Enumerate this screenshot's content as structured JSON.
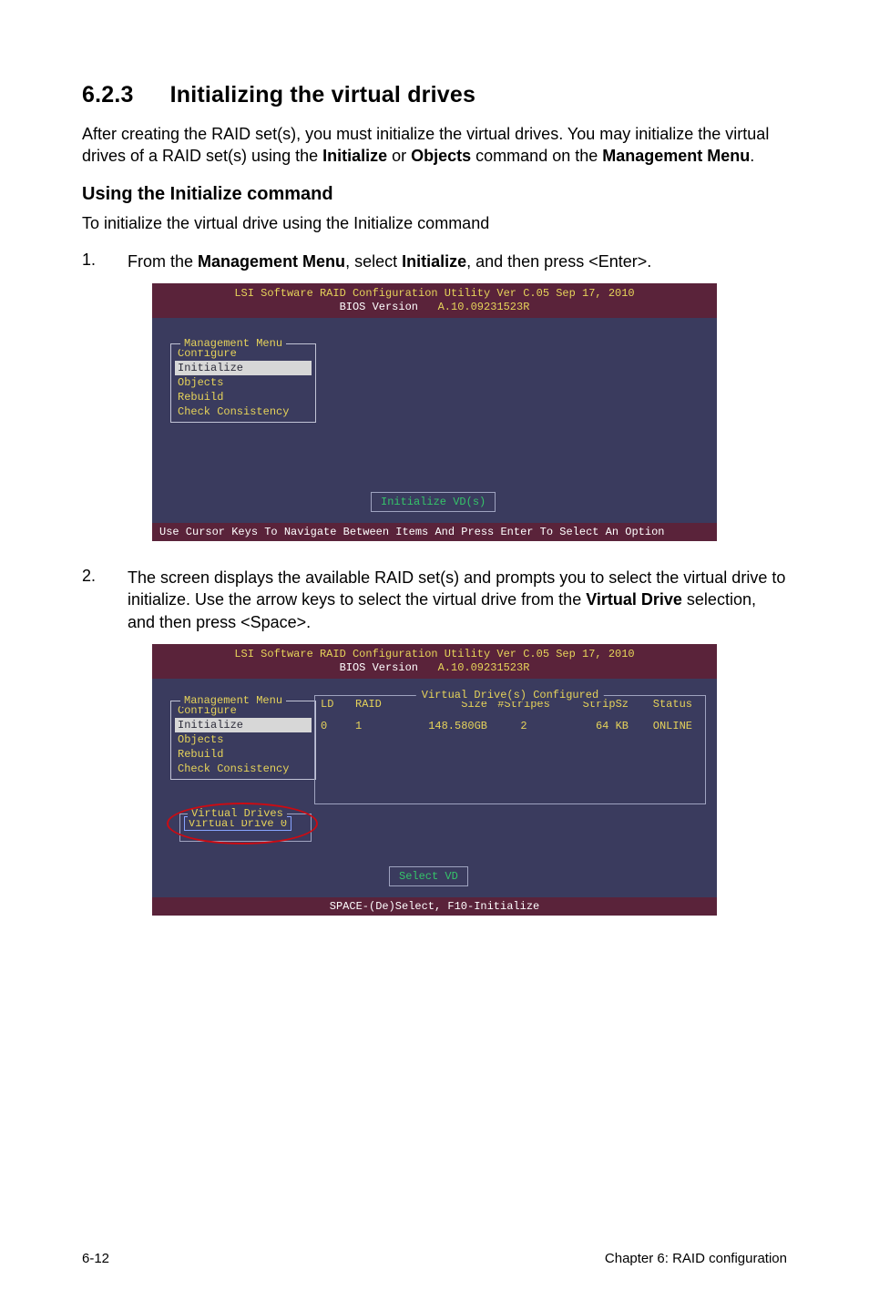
{
  "section": {
    "number": "6.2.3",
    "title": "Initializing the virtual drives"
  },
  "intro": {
    "part1": "After creating the RAID set(s), you must initialize the virtual drives. You may initialize the virtual drives of a RAID set(s) using the ",
    "bold1": "Initialize",
    "mid1": " or ",
    "bold2": "Objects",
    "mid2": " command on the ",
    "bold3": "Management Menu",
    "end": "."
  },
  "subhead": "Using the Initialize command",
  "subintro": "To initialize the virtual drive using the Initialize command",
  "step1": {
    "num": "1.",
    "pre": "From the ",
    "bold1": "Management Menu",
    "mid": ", select ",
    "bold2": "Initialize",
    "post": ", and then press <Enter>."
  },
  "step2": {
    "num": "2.",
    "part1": "The screen displays the available RAID set(s) and prompts you to select the virtual drive to initialize. Use the arrow keys to select the virtual drive from the ",
    "bold1": "Virtual Drive",
    "part2": " selection, and then press <Space>."
  },
  "bios_common": {
    "header_line1": "LSI Software RAID Configuration Utility Ver C.05 Sep 17, 2010",
    "header_line2_label": "BIOS Version",
    "header_line2_value": "A.10.09231523R",
    "menu_title": "Management Menu",
    "menu_items": {
      "configure": "Configure",
      "initialize": "Initialize",
      "objects": "Objects",
      "rebuild": "Rebuild",
      "check": "Check Consistency"
    }
  },
  "bios1": {
    "action": "Initialize VD(s)",
    "footer": "Use Cursor Keys To Navigate Between Items And Press Enter To Select An Option"
  },
  "bios2": {
    "table_title": "Virtual Drive(s) Configured",
    "headers": {
      "ld": "LD",
      "raid": "RAID",
      "size": "Size",
      "stripes": "#Stripes",
      "stripsz": "StripSz",
      "status": "Status"
    },
    "row0": {
      "ld": "0",
      "raid": "1",
      "size": "148.580GB",
      "stripes": "2",
      "stripsz": "64 KB",
      "status": "ONLINE"
    },
    "vd_title": "Virtual Drives",
    "vd_item0": "Virtual Drive 0",
    "action": "Select VD",
    "footer": "SPACE-(De)Select,  F10-Initialize"
  },
  "footer": {
    "left": "6-12",
    "right": "Chapter 6: RAID configuration"
  }
}
